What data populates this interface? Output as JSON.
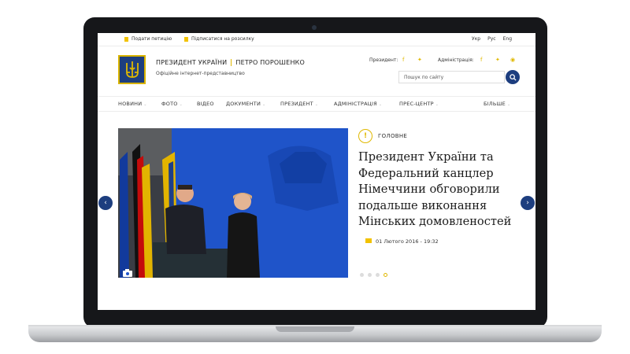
{
  "topbar": {
    "petition": "Подати петицію",
    "subscribe": "Підписатися на розсилку",
    "languages": [
      "Укр",
      "Рус",
      "Eng"
    ]
  },
  "header": {
    "title_left": "ПРЕЗИДЕНТ УКРАЇНИ",
    "title_right": "ПЕТРО ПОРОШЕНКО",
    "subtitle": "Офіційне інтернет-представництво",
    "president_label": "Президент:",
    "administration_label": "Адміністрація:",
    "search_placeholder": "Пошук по сайту"
  },
  "nav": {
    "items": [
      "НОВИНИ",
      "ФОТО",
      "ВІДЕО",
      "ДОКУМЕНТИ",
      "ПРЕЗИДЕНТ",
      "АДМІНІСТРАЦІЯ",
      "ПРЕС-ЦЕНТР"
    ],
    "more": "БІЛЬШЕ"
  },
  "slider": {
    "category": "ГОЛОВНЕ",
    "badge": "!",
    "headline": "Президент України та Федеральний канцлер Німеччини обговорили подальше виконання Мінських домовленостей",
    "date": "01 Лютого 2016 - 19:32",
    "prev_arrow": "‹",
    "next_arrow": "›",
    "slide_count": 4,
    "active_slide": 4
  },
  "colors": {
    "accent_yellow": "#e0b800",
    "navy": "#1d3e7f"
  }
}
